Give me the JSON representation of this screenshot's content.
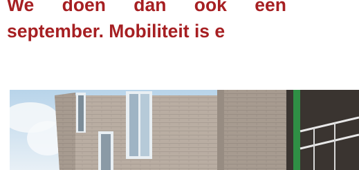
{
  "article": {
    "lines": [
      "We doen dan ook een",
      "september. Mobiliteit is e"
    ],
    "colors": {
      "heading_text": "#a61f22",
      "sky": "#c8dff0",
      "brick": "#b9ada2",
      "window_frame": "#e9eff3",
      "railing": "#2f8f45"
    },
    "image": {
      "subject": "brick-building-photo"
    }
  }
}
